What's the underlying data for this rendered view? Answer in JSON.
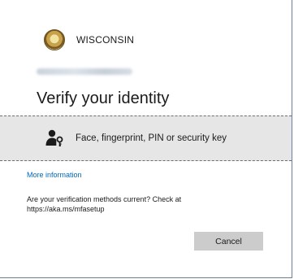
{
  "header": {
    "org_name": "WISCONSIN",
    "logo_icon": "state-seal-icon"
  },
  "title": "Verify your identity",
  "methods": [
    {
      "label": "Face, fingerprint, PIN or security key",
      "icon": "user-key-icon"
    }
  ],
  "links": {
    "more_information": "More information"
  },
  "notice": {
    "line1": "Are your verification methods current? Check at",
    "line2": "https://aka.ms/mfasetup"
  },
  "buttons": {
    "cancel": "Cancel"
  },
  "colors": {
    "link": "#0067b8",
    "method_bg": "#e6e6e6",
    "button_bg": "#cccccc",
    "border": "#6b7f96"
  }
}
